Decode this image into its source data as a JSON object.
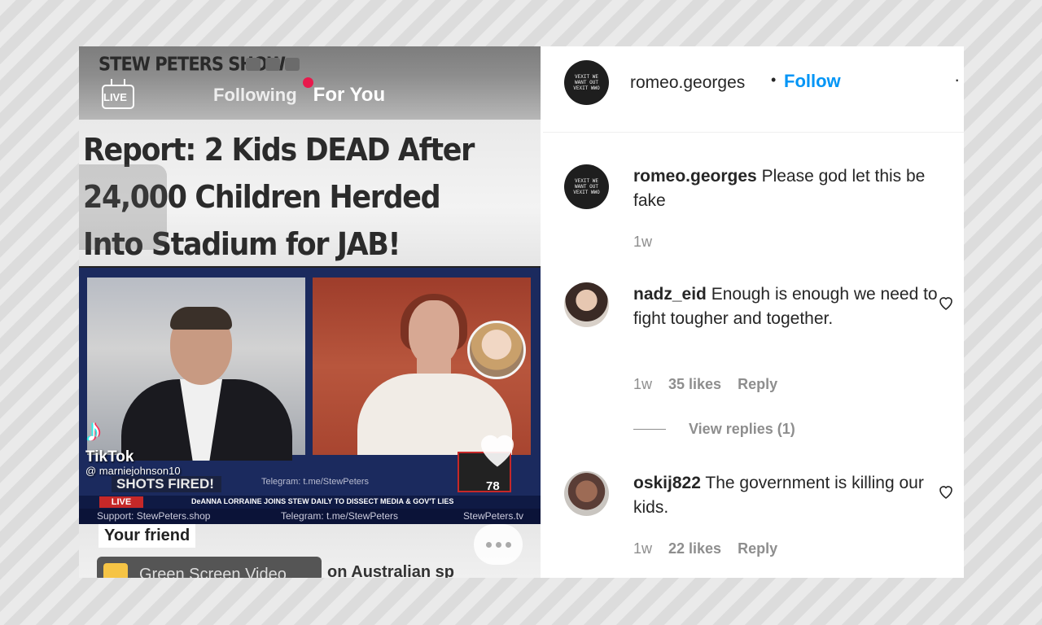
{
  "video": {
    "show_title": "STEW PETERS SHOW",
    "live_label": "LIVE",
    "tab_following": "Following",
    "tab_for_you": "For You",
    "headline": "Report: 2 Kids DEAD After 24,000 Children Herded Into Stadium for JAB!",
    "tiktok_logo": "♪",
    "tiktok_word": "TikTok",
    "tiktok_user": "@ marniejohnson10",
    "shots_fired": "SHOTS FIRED!",
    "telegram_mid": "Telegram: t.me/StewPeters",
    "ticker_live": "LIVE",
    "ticker_text": "DeANNA LORRAINE JOINS STEW DAILY TO DISSECT MEDIA & GOV'T LIES",
    "ticker2_support": "Support: StewPeters.shop",
    "ticker2_telegram": "Telegram: t.me/StewPeters",
    "ticker2_site": "StewPeters.tv",
    "like_count": "78",
    "your_friend": "Your friend",
    "green_chip": "Green Screen Video",
    "bottom_tail": "on Australian sp"
  },
  "instagram": {
    "header": {
      "username": "romeo.georges",
      "follow": "Follow",
      "dot": "•",
      "more": "·"
    },
    "avatar_text": "VEXIT WE WANT OUT VEXIT WWO",
    "comments": [
      {
        "username": "romeo.georges",
        "text": "Please god let this be fake",
        "time": "1w"
      },
      {
        "username": "nadz_eid",
        "text": "Enough is enough we need to fight tougher and together.",
        "time": "1w",
        "likes": "35 likes",
        "reply": "Reply",
        "view_replies": "View replies (1)"
      },
      {
        "username": "oskij822",
        "text": "The government is killing our kids.",
        "time": "1w",
        "likes": "22 likes",
        "reply": "Reply"
      }
    ]
  },
  "colors": {
    "follow_blue": "#0095f6",
    "meta_gray": "#8e8e8e",
    "text_dark": "#262626"
  }
}
